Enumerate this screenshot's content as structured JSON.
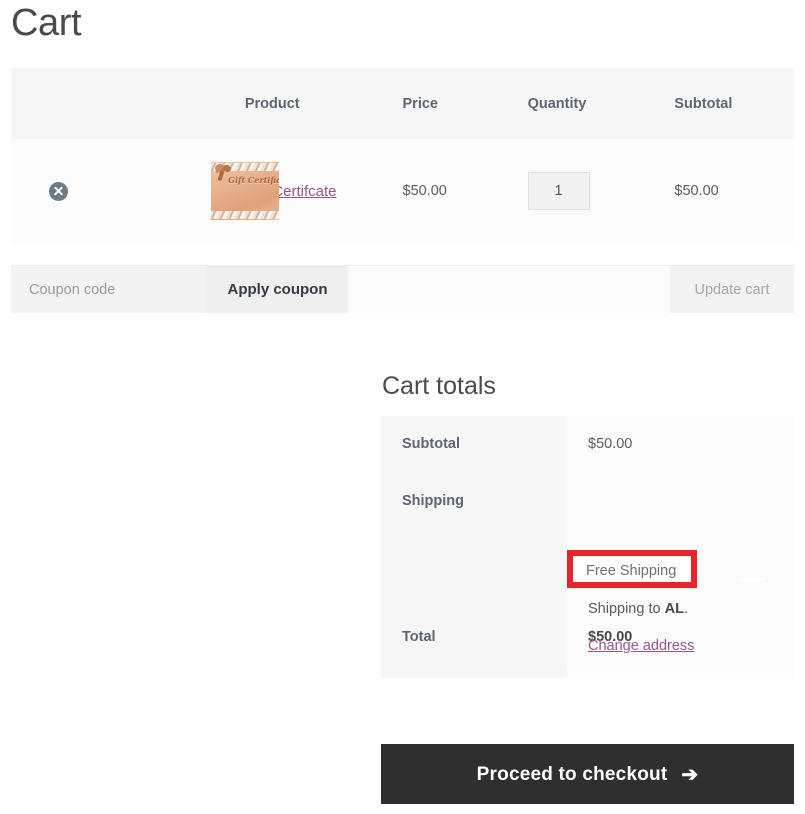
{
  "page": {
    "title": "Cart"
  },
  "cart_table": {
    "headers": {
      "remove": "",
      "thumbnail": "",
      "product": "Product",
      "price": "Price",
      "quantity": "Quantity",
      "subtotal": "Subtotal"
    },
    "items": [
      {
        "remove_icon": "remove-circle-icon",
        "thumbnail_alt": "Gift Certificate",
        "thumbnail_caption": "Gift Certificate",
        "name": "Gift Certifcate",
        "price": "$50.00",
        "quantity": "1",
        "subtotal": "$50.00"
      }
    ]
  },
  "actions": {
    "coupon_placeholder": "Coupon code",
    "coupon_value": "",
    "apply_coupon_label": "Apply coupon",
    "update_cart_label": "Update cart"
  },
  "cart_totals": {
    "heading": "Cart totals",
    "subtotal_label": "Subtotal",
    "subtotal_value": "$50.00",
    "shipping_label": "Shipping",
    "shipping_method": "Free Shipping",
    "shipping_to_prefix": "Shipping to ",
    "shipping_to_state": "AL",
    "shipping_to_suffix": ".",
    "change_address_label": "Change address",
    "total_label": "Total",
    "total_value": "$50.00"
  },
  "checkout": {
    "label": "Proceed to checkout",
    "arrow_icon": "arrow-right-icon",
    "arrow_glyph": "➔"
  },
  "colors": {
    "link": "#96588a",
    "highlight_box": "#e8232a",
    "checkout_bg": "#2f2f2f",
    "header_text": "#5f6672"
  }
}
